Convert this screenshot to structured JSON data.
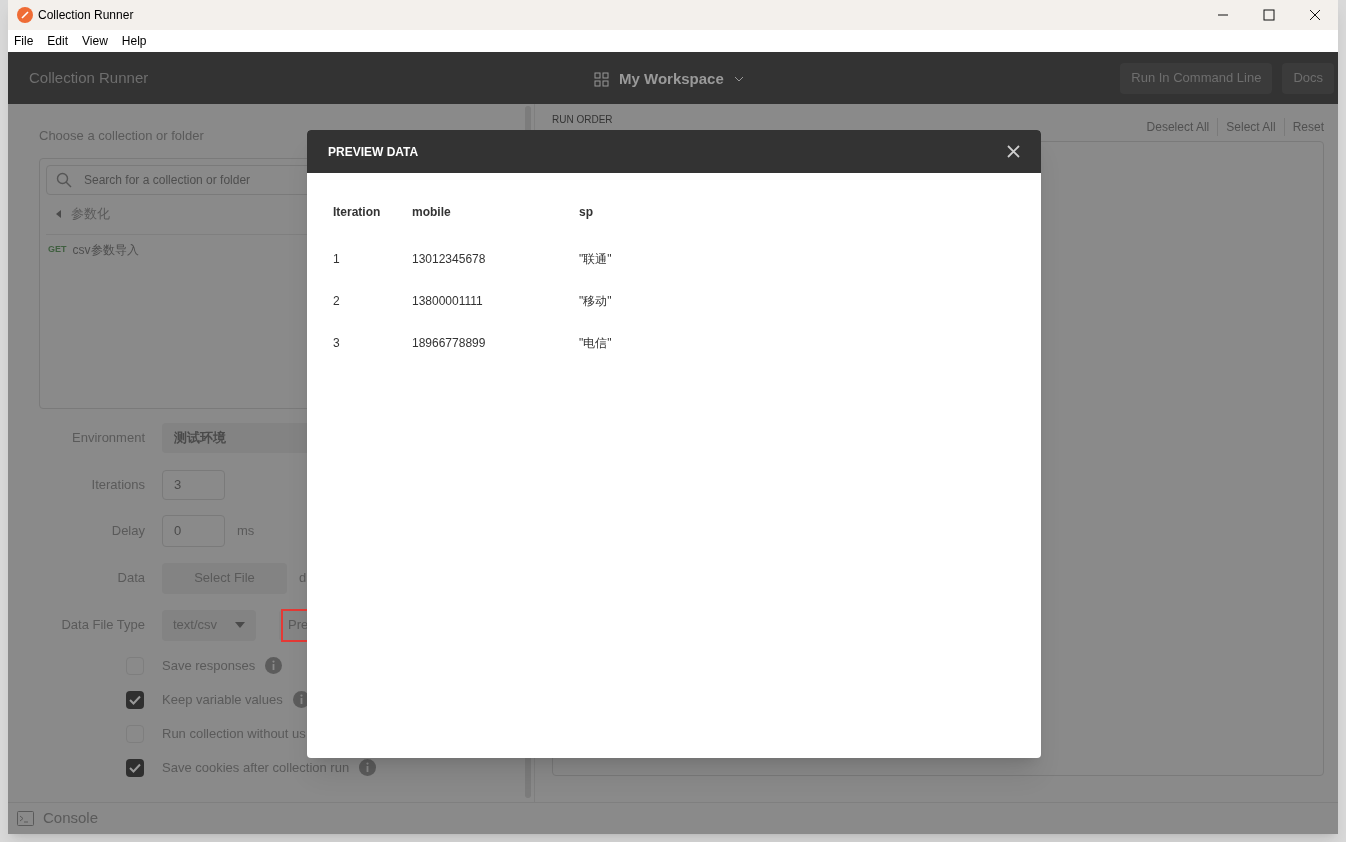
{
  "window": {
    "title": "Collection Runner"
  },
  "menu": [
    "File",
    "Edit",
    "View",
    "Help"
  ],
  "header": {
    "title": "Collection Runner",
    "workspace": "My Workspace",
    "buttons": [
      "Run In Command Line",
      "Docs"
    ]
  },
  "collection_picker": {
    "heading": "Choose a collection or folder",
    "search": {
      "placeholder": "Search for a collection or folder"
    },
    "folder": "参数化",
    "requests": [
      {
        "method": "GET",
        "name": "csv参数导入"
      }
    ]
  },
  "settings": {
    "environment": {
      "label": "Environment",
      "value": "测试环境"
    },
    "iterations": {
      "label": "Iterations",
      "value": "3"
    },
    "delay": {
      "label": "Delay",
      "value": "0",
      "unit": "ms"
    },
    "data": {
      "label": "Data",
      "button": "Select File",
      "file": "d"
    },
    "data_file_type": {
      "label": "Data File Type",
      "value": "text/csv",
      "preview": "Pre"
    },
    "options": [
      {
        "label": "Save responses",
        "checked": false,
        "info": true
      },
      {
        "label": "Keep variable values",
        "checked": true,
        "info": true
      },
      {
        "label": "Run collection without us",
        "checked": false
      },
      {
        "label": "Save cookies after collection run",
        "checked": true,
        "info": true
      }
    ]
  },
  "run_order": {
    "heading": "RUN ORDER",
    "actions": [
      "Deselect All",
      "Select All",
      "Reset"
    ]
  },
  "console": "Console",
  "modal": {
    "title": "PREVIEW DATA",
    "columns": [
      "Iteration",
      "mobile",
      "sp"
    ],
    "rows": [
      [
        "1",
        "13012345678",
        "\"联通\""
      ],
      [
        "2",
        "13800001111",
        "\"移动\""
      ],
      [
        "3",
        "18966778899",
        "\"电信\""
      ]
    ]
  }
}
